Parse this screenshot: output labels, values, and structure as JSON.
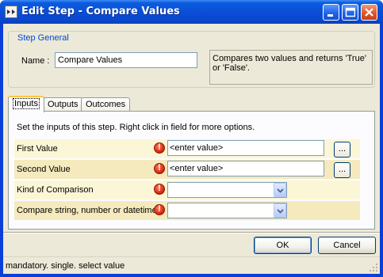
{
  "window": {
    "title": "Edit Step - Compare Values",
    "icon": "step-icon",
    "controls": [
      "minimize-icon",
      "maximize-icon",
      "close-icon"
    ],
    "colors": {
      "titlebar": "#0a4fd6",
      "close": "#e0572c",
      "face": "#ece9d8"
    }
  },
  "step_general": {
    "legend": "Step General",
    "name_label": "Name :",
    "name_value": "Compare Values",
    "description": "Compares two values and returns 'True' or 'False'."
  },
  "tabs": [
    {
      "label": "Inputs",
      "active": true
    },
    {
      "label": "Outputs",
      "active": false
    },
    {
      "label": "Outcomes",
      "active": false
    }
  ],
  "inputs": {
    "instructions": "Set the inputs of this step.  Right click in field for more options.",
    "rows": [
      {
        "label": "First Value",
        "value": "<enter value>",
        "button": "..."
      },
      {
        "label": "Second Value",
        "value": "<enter value>",
        "button": "..."
      },
      {
        "label": "Kind of Comparison",
        "value": ""
      },
      {
        "label": "Compare string, number or datetime",
        "value": ""
      }
    ]
  },
  "buttons": {
    "ok": "OK",
    "cancel": "Cancel"
  },
  "status": {
    "text": "mandatory. single. select value"
  }
}
